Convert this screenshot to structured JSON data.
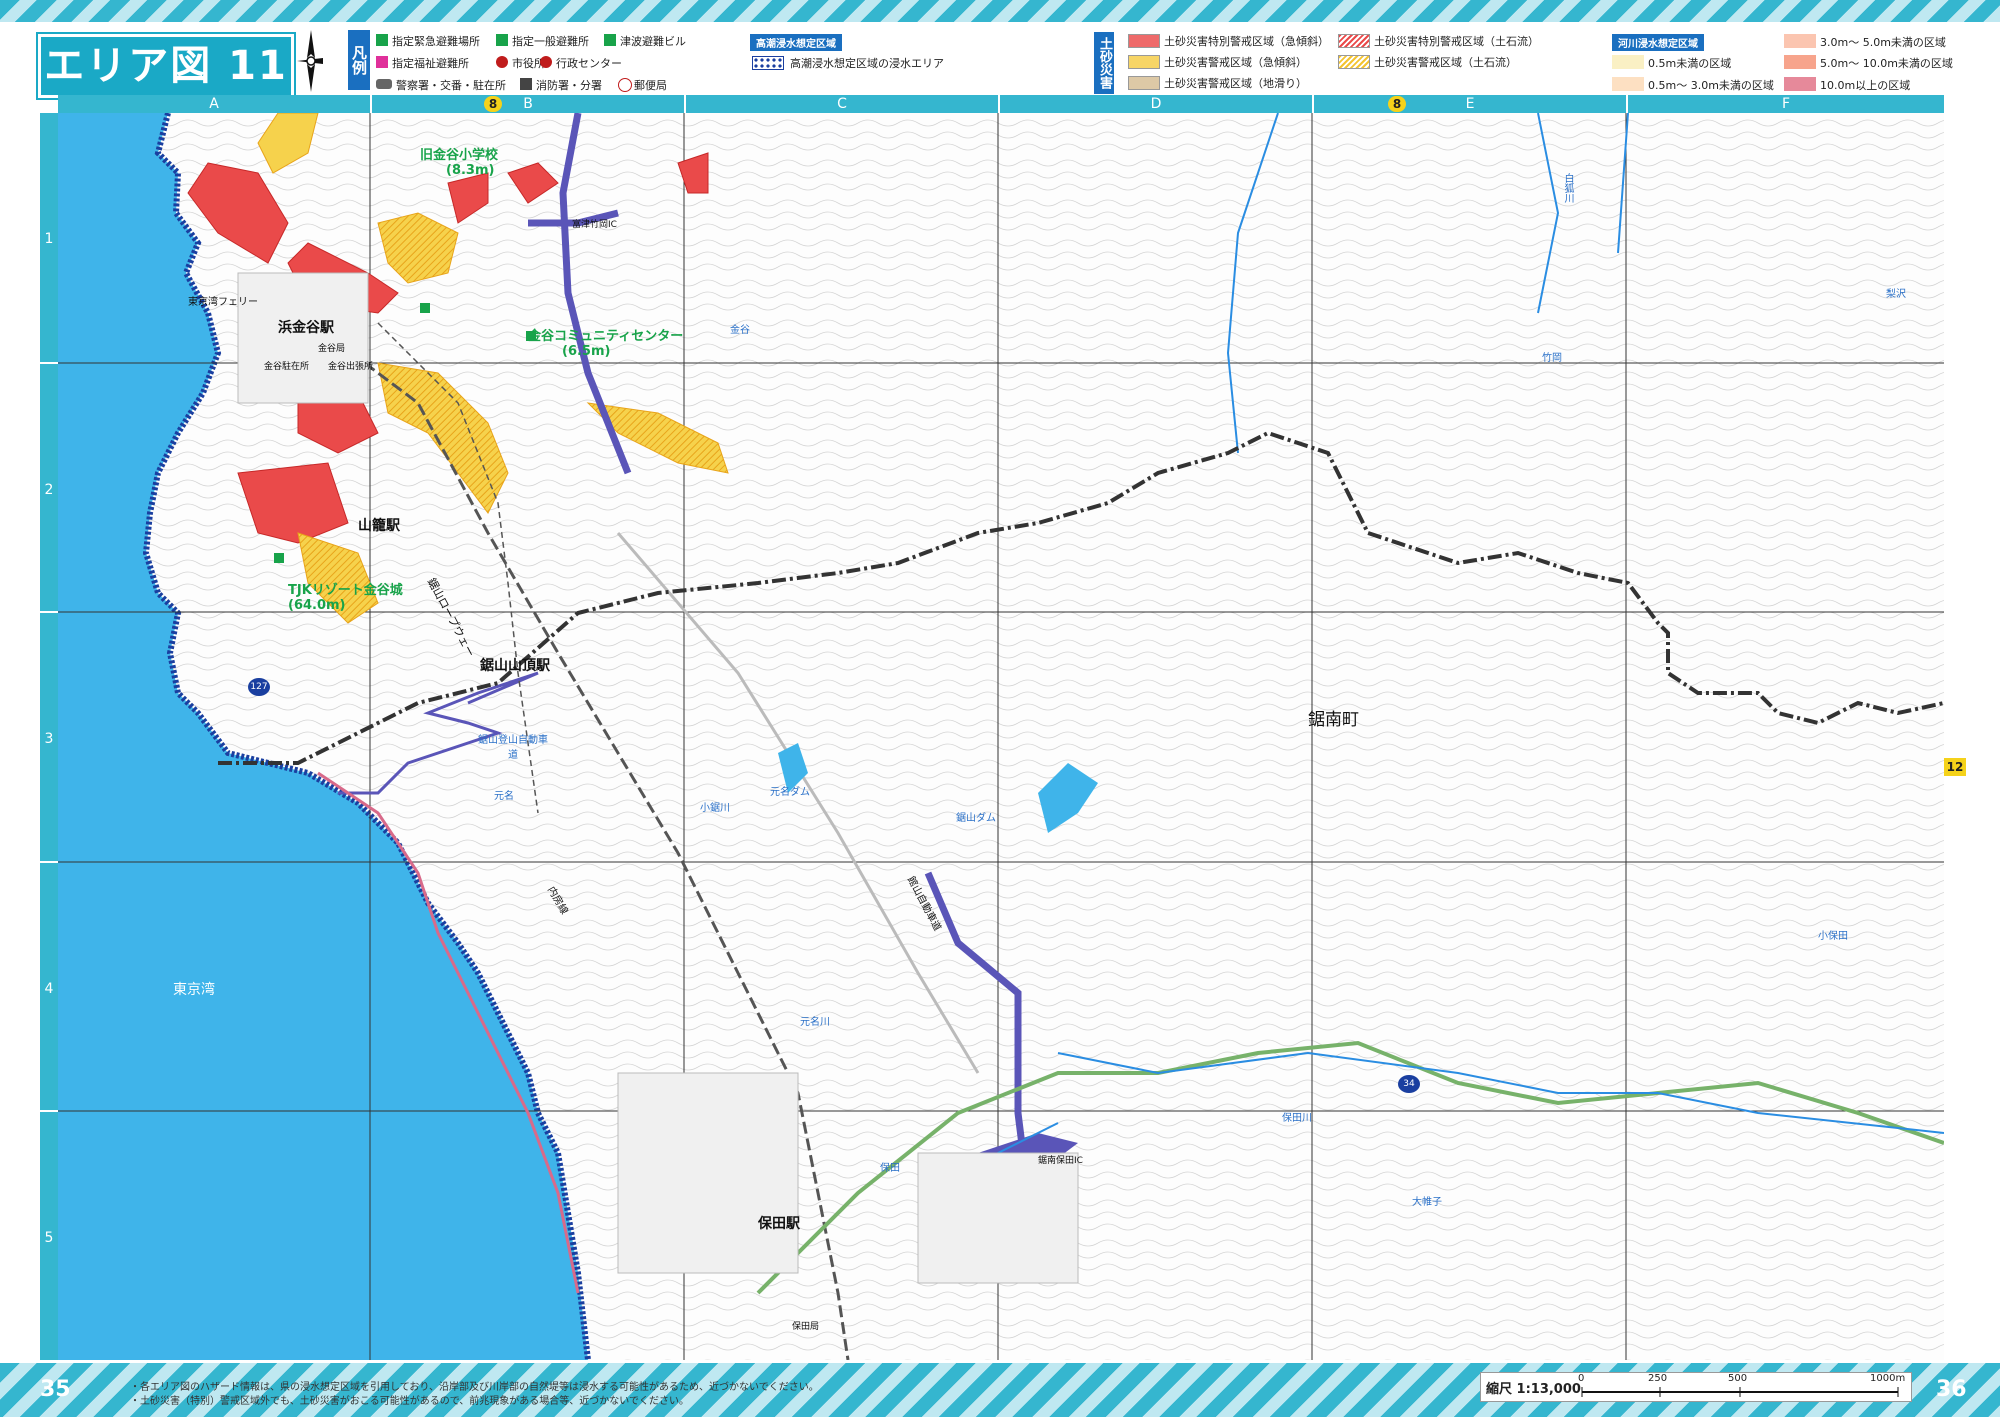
{
  "header": {
    "area_title": "エリア図 11",
    "legend_tag": "凡例",
    "legend_items": [
      "指定緊急避難場所",
      "指定一般避難所",
      "津波避難ビル",
      "指定福祉避難所",
      "市役所",
      "行政センター",
      "警察署・交番・駐在所",
      "消防署・分署",
      "郵便局"
    ],
    "takashio_tag": "高潮浸水想定区域",
    "takashio_item": "高潮浸水想定区域の浸水エリア",
    "dosha_tag": "土砂災害",
    "dosha_items": [
      "土砂災害特別警戒区域（急傾斜）",
      "土砂災害警戒区域（急傾斜）",
      "土砂災害警戒区域（地滑り）",
      "土砂災害特別警戒区域（土石流）",
      "土砂災害警戒区域（土石流）"
    ],
    "kasen_tag": "河川浸水想定区域",
    "kasen_items": [
      "0.5m未満の区域",
      "0.5m～ 3.0m未満の区域",
      "3.0m～ 5.0m未満の区域",
      "5.0m～ 10.0m未満の区域",
      "10.0m以上の区域"
    ],
    "colors": {
      "accent": "#35b6cf",
      "tag_blue": "#1a6fc0",
      "sea": "#3fb4ea",
      "danger_red": "#ea4a4a",
      "warning_yellow": "#f4c431",
      "route_purple": "#5a55b8"
    }
  },
  "grid": {
    "columns": [
      "A",
      "B",
      "C",
      "D",
      "E",
      "F"
    ],
    "rows": [
      "1",
      "2",
      "3",
      "4",
      "5"
    ],
    "route_badges": [
      "8",
      "8"
    ],
    "edge_badge": "12"
  },
  "map": {
    "stations": [
      "浜金谷駅",
      "山籠駅",
      "鋸山山頂駅",
      "保田駅"
    ],
    "shelters": [
      {
        "name": "旧金谷小学校",
        "elev": "(8.3m)"
      },
      {
        "name": "金谷コミュニティセンター",
        "elev": "(6.5m)"
      },
      {
        "name": "TJKリゾート金谷城",
        "elev": "(64.0m)"
      }
    ],
    "places": [
      "鋸南町",
      "東京湾",
      "金谷",
      "竹岡",
      "梨沢",
      "元名",
      "保田",
      "大帷子",
      "小保田",
      "東京湾フェリー",
      "金谷局",
      "金谷駐在所",
      "金谷出張所",
      "保田局"
    ],
    "roads": [
      "鋸山ロープウェー",
      "鋸山登山自動車道",
      "富津竹岡IC",
      "鋸南保田IC",
      "館山自動車道",
      "内房線"
    ],
    "rivers": [
      "小鋸川",
      "元名川",
      "保田川",
      "白狐川",
      "鋸山ダム",
      "元名ダム"
    ],
    "route_numbers": [
      "127",
      "34"
    ]
  },
  "footer": {
    "page_left": "35",
    "page_right": "36",
    "note1": "・各エリア図のハザード情報は、県の浸水想定区域を引用しており、沿岸部及び川岸部の自然堤等は浸水する可能性があるため、近づかないでください。",
    "note2": "・土砂災害（特別）警戒区域外でも、土砂災害がおこる可能性があるので、前兆現象がある場合等、近づかないでください。",
    "scale_label": "縮尺 1:13,000",
    "scale_ticks": [
      "0",
      "250",
      "500",
      "1000m"
    ]
  }
}
